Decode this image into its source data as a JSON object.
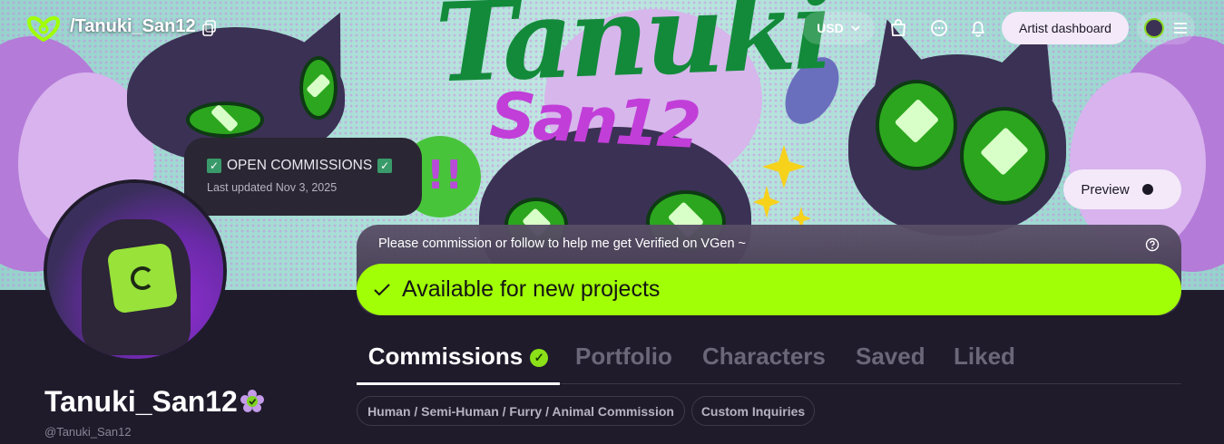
{
  "header": {
    "handle_path": "/Tanuki_San12",
    "currency": "USD",
    "artist_dashboard_label": "Artist dashboard"
  },
  "banner": {
    "title_art": "Tanuki",
    "subtitle_art": "San12"
  },
  "status": {
    "commissions_text": "OPEN COMMISSIONS",
    "last_updated": "Last updated Nov 3, 2025"
  },
  "preview_label": "Preview",
  "notice": {
    "text": "Please commission or follow to help me get Verified on VGen ~"
  },
  "availability": {
    "text": "Available for new projects"
  },
  "profile": {
    "display_name": "Tanuki_San12",
    "handle": "@Tanuki_San12"
  },
  "tabs": [
    {
      "label": "Commissions",
      "active": true
    },
    {
      "label": "Portfolio"
    },
    {
      "label": "Characters"
    },
    {
      "label": "Saved"
    },
    {
      "label": "Liked"
    }
  ],
  "categories": [
    "Human / Semi-Human / Furry / Animal Commission",
    "Custom Inquiries"
  ],
  "icons": [
    "logo-icon",
    "copy-icon",
    "chevron-down-icon",
    "bag-icon",
    "chat-icon",
    "bell-icon",
    "menu-icon",
    "help-icon",
    "check-icon",
    "verified-icon"
  ],
  "colors": {
    "available_green": "#a1ff06",
    "background": "#1f1b2b",
    "pill_light": "#f3e9f8"
  }
}
